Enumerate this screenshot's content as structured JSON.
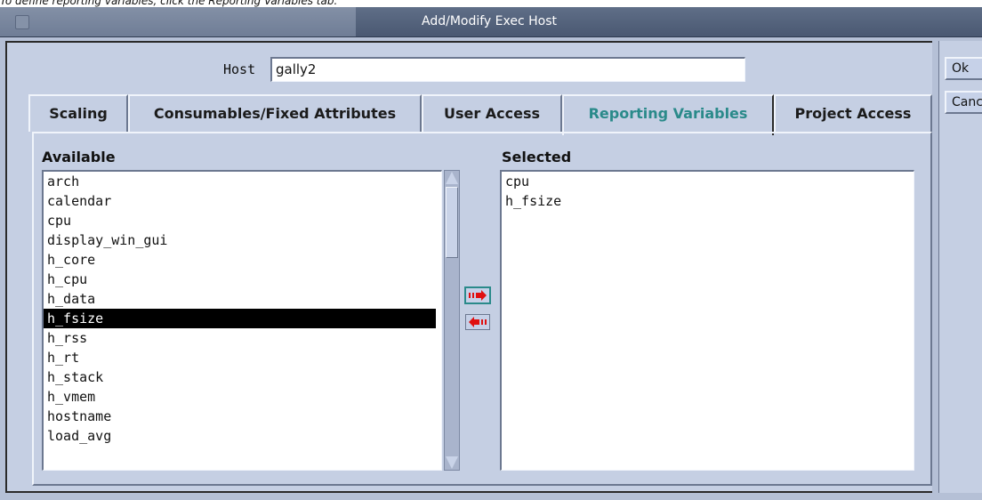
{
  "caption": "To define reporting variables, click the Reporting Variables tab.",
  "window": {
    "title": "Add/Modify Exec Host"
  },
  "host": {
    "label": "Host",
    "value": "gally2"
  },
  "tabs": [
    {
      "label": "Scaling",
      "active": false
    },
    {
      "label": "Consumables/Fixed Attributes",
      "active": false
    },
    {
      "label": "User Access",
      "active": false
    },
    {
      "label": "Reporting Variables",
      "active": true
    },
    {
      "label": "Project Access",
      "active": false
    }
  ],
  "available": {
    "label": "Available",
    "items": [
      "arch",
      "calendar",
      "cpu",
      "display_win_gui",
      "h_core",
      "h_cpu",
      "h_data",
      "h_fsize",
      "h_rss",
      "h_rt",
      "h_stack",
      "h_vmem",
      "hostname",
      "load_avg"
    ],
    "selected_item": "h_fsize"
  },
  "selected": {
    "label": "Selected",
    "items": [
      "cpu",
      "h_fsize"
    ]
  },
  "side_buttons": {
    "ok": "Ok",
    "cancel": "Cancel"
  },
  "colors": {
    "accent": "#2a8a8a",
    "titlebar": "#4a5872",
    "panel": "#c5cfe3",
    "arrow_red": "#e01010"
  }
}
